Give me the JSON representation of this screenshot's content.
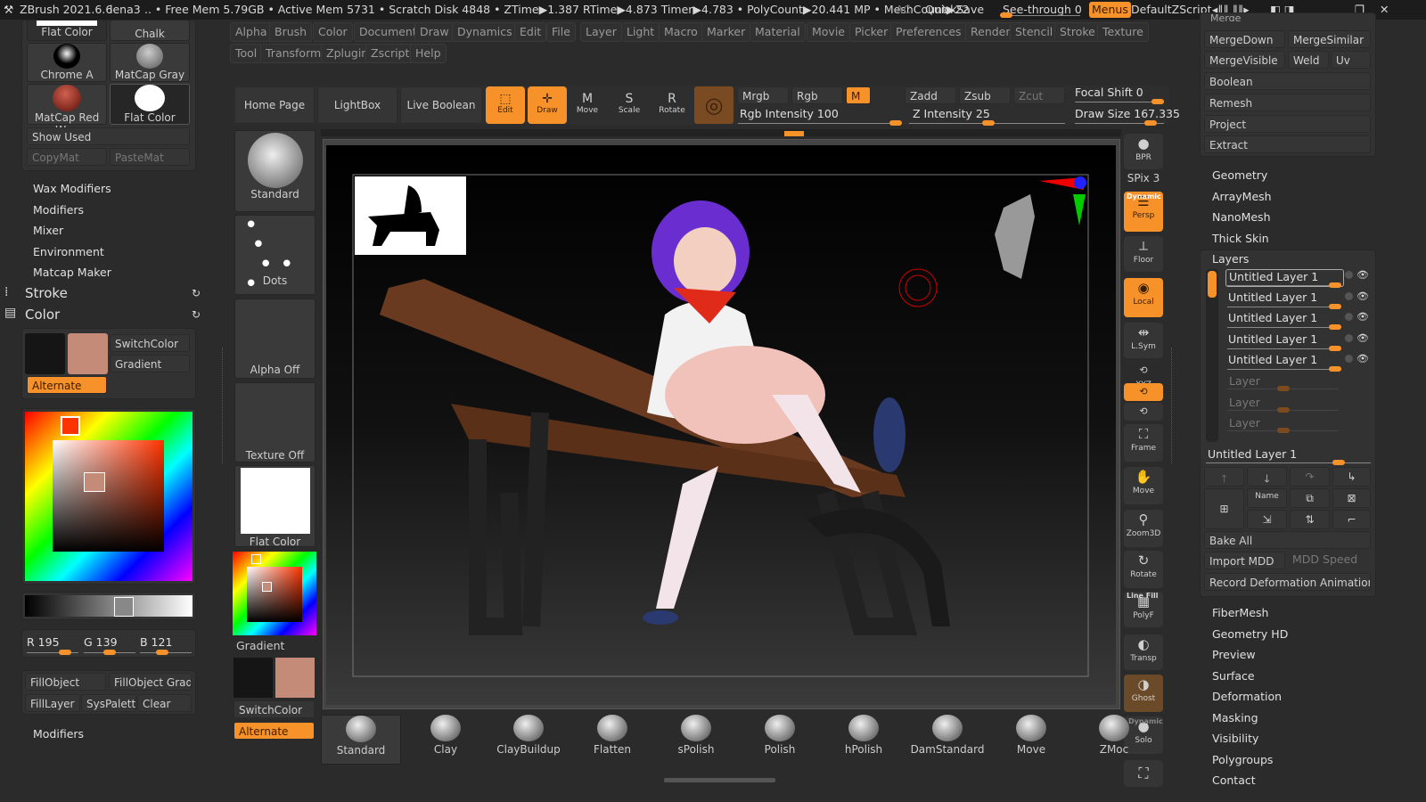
{
  "topbar": {
    "app": "ZBrush 2021.6.6",
    "doc": "lena3",
    "stats": ".. • Free Mem 5.79GB • Active Mem 5731 • Scratch Disk 4848 • ZTime▶1.387 RTime▶4.873 Timer▶4.783 • PolyCount▶20.441 MP • MeshCount▶22",
    "ac": "AC",
    "quicksave": "QuickSave",
    "seethrough": "See-through  0",
    "menus": "Menus",
    "script": "DefaultZScript"
  },
  "menus": {
    "row1": [
      "Alpha",
      "Brush",
      "Color",
      "Document",
      "Draw",
      "Dynamics",
      "Edit",
      "File",
      "Layer",
      "Light",
      "Macro",
      "Marker",
      "Material",
      "Movie",
      "Picker",
      "Preferences",
      "Render",
      "Stencil",
      "Stroke",
      "Texture"
    ],
    "row2": [
      "Tool",
      "Transform",
      "Zplugin",
      "Zscript",
      "Help"
    ]
  },
  "left": {
    "materials": [
      "Flat Color",
      "Chalk",
      "Chrome A",
      "MatCap Gray",
      "MatCap Red Wax",
      "Flat Color"
    ],
    "show_used": "Show Used",
    "copymat": "CopyMat",
    "pastemat": "PasteMat",
    "subs": [
      "Wax Modifiers",
      "Modifiers",
      "Mixer",
      "Environment",
      "Matcap Maker"
    ],
    "stroke": "Stroke",
    "color": "Color",
    "switchcolor": "SwitchColor",
    "gradient": "Gradient",
    "alternate": "Alternate",
    "r": "R 195",
    "g": "G 139",
    "b": "B 121",
    "fill": [
      "FillObject",
      "FillObject Grad",
      "FillLayer",
      "SysPalette",
      "Clear"
    ],
    "modifiers": "Modifiers",
    "main_color": "#c48b79",
    "secondary_color": "#151515"
  },
  "shelf": {
    "home": "Home Page",
    "lightbox": "LightBox",
    "liveboolean": "Live Boolean",
    "edit": "Edit",
    "draw": "Draw",
    "move": "Move",
    "scale": "Scale",
    "rotate": "Rotate",
    "mrgb": "Mrgb",
    "rgb": "Rgb",
    "m": "M",
    "rgb_int": "Rgb Intensity 100",
    "zadd": "Zadd",
    "zsub": "Zsub",
    "zcut": "Zcut",
    "z_int": "Z Intensity 25",
    "focal": "Focal Shift 0",
    "drawsize": "Draw Size 167.335",
    "rgb_intensity": 100,
    "z_intensity": 25
  },
  "tray": {
    "brush": "Standard",
    "stroke": "Dots",
    "alpha": "Alpha Off",
    "texture": "Texture Off",
    "material": "Flat Color",
    "gradient": "Gradient",
    "switchcolor": "SwitchColor",
    "alternate": "Alternate"
  },
  "rshelf": [
    "BPR",
    "SPix 3",
    "Persp",
    "Floor",
    "Local",
    "L.Sym",
    "XYZ",
    "Frame",
    "Move",
    "Zoom3D",
    "Rotate",
    "PolyF",
    "Transp",
    "Ghost",
    "Solo"
  ],
  "rshelf_labels": {
    "dynamic": "Dynamic",
    "linefill": "Line Fill"
  },
  "brushes": [
    "Standard",
    "Clay",
    "ClayBuildup",
    "Flatten",
    "sPolish",
    "Polish",
    "hPolish",
    "DamStandard",
    "Move",
    "ZMoc"
  ],
  "right": {
    "merge": "Merge",
    "mergedown": "MergeDown",
    "mergesimilar": "MergeSimilar",
    "mergevisible": "MergeVisible",
    "weld": "Weld",
    "uv": "Uv",
    "boolean": "Boolean",
    "remesh": "Remesh",
    "project": "Project",
    "extract": "Extract",
    "sections": [
      "Geometry",
      "ArrayMesh",
      "NanoMesh",
      "Thick Skin"
    ],
    "layers_title": "Layers",
    "layers": [
      "Untitled Layer 1",
      "Untitled Layer 1",
      "Untitled Layer 1",
      "Untitled Layer 1",
      "Untitled Layer 1"
    ],
    "empty_layers": [
      "Layer",
      "Layer",
      "Layer"
    ],
    "current_layer": "Untitled Layer 1",
    "name": "Name",
    "bake": "Bake All",
    "import": "Import MDD",
    "mddspeed": "MDD Speed",
    "record": "Record Deformation Animation",
    "lower": [
      "FiberMesh",
      "Geometry HD",
      "Preview",
      "Surface",
      "Deformation",
      "Masking",
      "Visibility",
      "Polygroups",
      "Contact"
    ]
  }
}
